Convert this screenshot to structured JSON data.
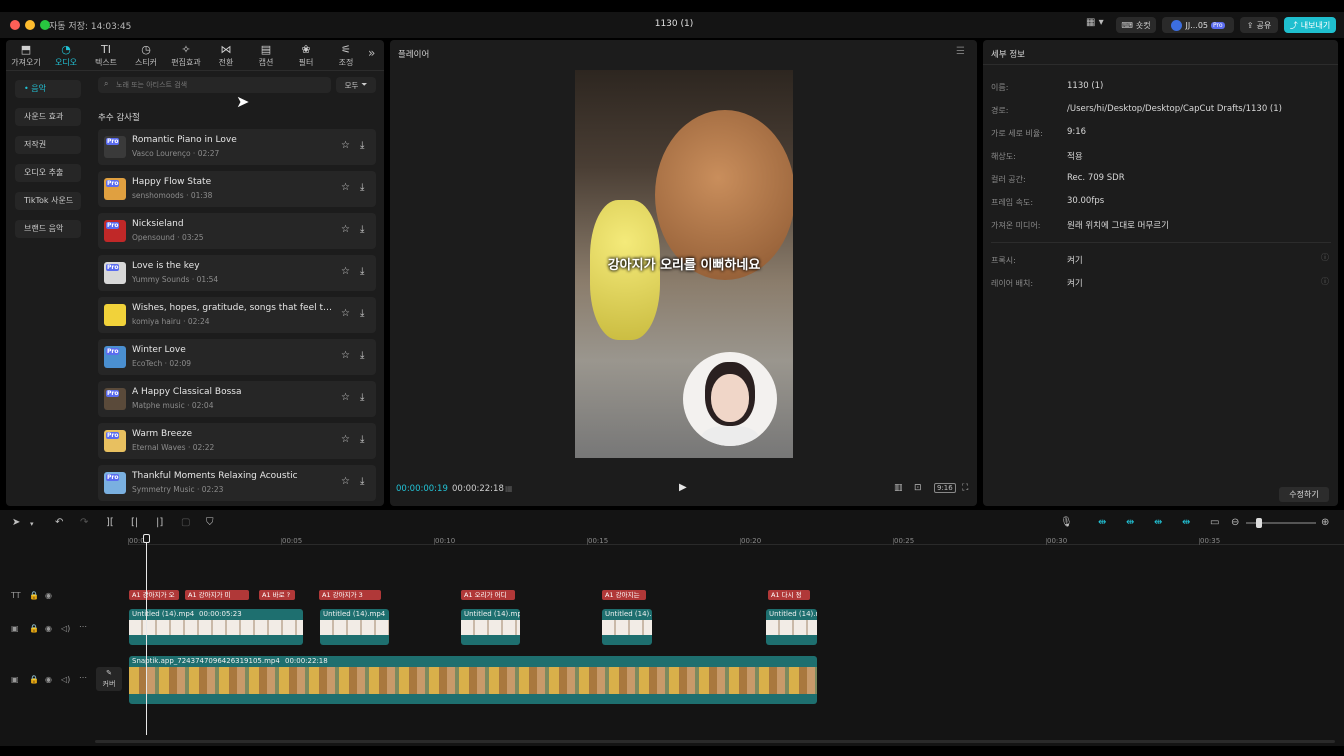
{
  "window": {
    "autosave": "자동 저장: 14:03:45",
    "title": "1130 (1)"
  },
  "topright": {
    "shortcut_label": "숏컷",
    "user_label": "JJ...05",
    "pro_badge": "Pro",
    "share_label": "공유",
    "export_label": "내보내기"
  },
  "toolbar": [
    {
      "label": "가져오기",
      "icon": "import-icon"
    },
    {
      "label": "오디오",
      "icon": "audio-icon"
    },
    {
      "label": "텍스트",
      "icon": "text-icon"
    },
    {
      "label": "스티커",
      "icon": "sticker-icon"
    },
    {
      "label": "편집효과",
      "icon": "effects-icon"
    },
    {
      "label": "전환",
      "icon": "transition-icon"
    },
    {
      "label": "캡션",
      "icon": "caption-icon"
    },
    {
      "label": "필터",
      "icon": "filter-icon"
    },
    {
      "label": "조정",
      "icon": "adjust-icon"
    }
  ],
  "categories": [
    "• 음악",
    "사운드 효과",
    "저작권",
    "오디오 추출",
    "TikTok 사운드",
    "브랜드 음악"
  ],
  "search": {
    "placeholder": "노래 또는 아티스트 검색",
    "filter_label": "모두"
  },
  "section_title": "추수 감사절",
  "tracks": [
    {
      "name": "Romantic Piano in Love",
      "artist": "Vasco Lourenço",
      "duration": "02:27",
      "badge": "Pro",
      "color": "#3a3a3a"
    },
    {
      "name": "Happy Flow State",
      "artist": "senshomoods",
      "duration": "01:38",
      "badge": "Pro",
      "color": "#e0a040"
    },
    {
      "name": "Nicksieland",
      "artist": "Opensound",
      "duration": "03:25",
      "badge": "Pro",
      "color": "#c02828"
    },
    {
      "name": "Love is the key",
      "artist": "Yummy Sounds",
      "duration": "01:54",
      "badge": "Pro",
      "color": "#d8d8d8"
    },
    {
      "name": "Wishes, hopes, gratitude, songs that feel the warmth of Thanksgiving",
      "artist": "komiya hairu",
      "duration": "02:24",
      "badge": "",
      "color": "#f1d23a"
    },
    {
      "name": "Winter Love",
      "artist": "EcoTech",
      "duration": "02:09",
      "badge": "Pro",
      "color": "#4a8fd0"
    },
    {
      "name": "A Happy Classical Bossa",
      "artist": "Matphe music",
      "duration": "02:04",
      "badge": "Pro",
      "color": "#5a4a3a"
    },
    {
      "name": "Warm Breeze",
      "artist": "Eternal Waves",
      "duration": "02:22",
      "badge": "Pro",
      "color": "#e8c060"
    },
    {
      "name": "Thankful Moments Relaxing Acoustic",
      "artist": "Symmetry Music",
      "duration": "02:23",
      "badge": "Pro",
      "color": "#7ab0e0"
    }
  ],
  "player": {
    "title": "플레이어",
    "subtitle": "강아지가 오리를 이뻐하네요",
    "current_time": "00:00:00:19",
    "total_time": "00:00:22:18",
    "ratio_label": "9:16"
  },
  "details": {
    "title": "세부 정보",
    "rows": [
      {
        "label": "이름:",
        "value": "1130 (1)"
      },
      {
        "label": "경로:",
        "value": "/Users/hi/Desktop/Desktop/CapCut Drafts/1130 (1)"
      },
      {
        "label": "가로 세로 비율:",
        "value": "9:16"
      },
      {
        "label": "해상도:",
        "value": "적용"
      },
      {
        "label": "컬러 공간:",
        "value": "Rec. 709 SDR"
      },
      {
        "label": "프레임 속도:",
        "value": "30.00fps"
      },
      {
        "label": "가져온 미디어:",
        "value": "원래 위치에 그대로 머무르기"
      }
    ],
    "rows2": [
      {
        "label": "프록시:",
        "value": "켜기"
      },
      {
        "label": "레이어 배치:",
        "value": "켜기"
      }
    ],
    "modify_label": "수정하기"
  },
  "timeline": {
    "ruler": [
      "00:00",
      "00:05",
      "00:10",
      "00:15",
      "00:20",
      "00:25",
      "00:30",
      "00:35"
    ],
    "text_clips": [
      "A1 강아지가 오",
      "A1 강아지가 미",
      "A1 바로 ?",
      "A1 강아지가 3",
      "A1 오리가 어디",
      "A1 강아지는",
      "A1 다시 정"
    ],
    "video_clips": [
      {
        "name": "Untitled (14).mp4",
        "duration": "00:00:05:23"
      },
      {
        "name": "Untitled (14).mp4",
        "duration": ""
      },
      {
        "name": "Untitled (14).mp",
        "duration": ""
      },
      {
        "name": "Untitled (14).r",
        "duration": ""
      },
      {
        "name": "Untitled (14).r",
        "duration": ""
      }
    ],
    "main_clip": {
      "name": "Snaptik.app_7243747096426319105.mp4",
      "duration": "00:00:22:18"
    },
    "cover_label": "커버"
  },
  "colors": {
    "accent": "#22c3d6",
    "text_clip": "#b03838",
    "video_clip": "#1e6f6f"
  }
}
